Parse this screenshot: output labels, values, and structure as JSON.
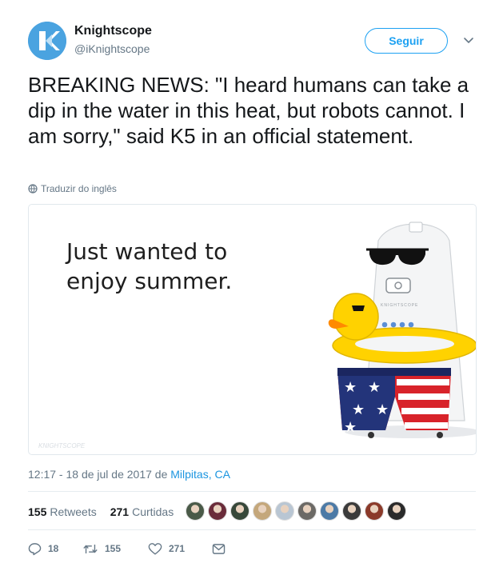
{
  "author": {
    "name": "Knightscope",
    "handle": "@iKnightscope",
    "avatar_color": "#4aa3e0"
  },
  "follow_label": "Seguir",
  "tweet": {
    "text": "BREAKING NEWS: \"I heard humans can take a dip in the water in this heat, but robots cannot. I am sorry,\" said K5 in an official statement.",
    "translate_label": "Traduzir do inglês"
  },
  "media": {
    "caption_line1": "Just wanted to",
    "caption_line2": "enjoy summer.",
    "robot_label": "KNIGHTSCOPE",
    "watermark": "KNIGHTSCOPE"
  },
  "meta": {
    "time": "12:17 - 18 de jul de 2017 de ",
    "location": "Milpitas, CA"
  },
  "stats": {
    "retweets_count": "155",
    "retweets_label": "Retweets",
    "likes_count": "271",
    "likes_label": "Curtidas"
  },
  "liker_avatars": [
    "#4a5a48",
    "#6a2c3a",
    "#37483a",
    "#c4a77b",
    "#b9c6d3",
    "#6c6a66",
    "#4c7aa6",
    "#3b3b3b",
    "#8b3a2a",
    "#2a2a2a"
  ],
  "actions": {
    "reply_count": "18",
    "retweet_count": "155",
    "like_count": "271"
  },
  "colors": {
    "accent": "#1da1f2",
    "text": "#14171a",
    "secondary": "#657786"
  }
}
